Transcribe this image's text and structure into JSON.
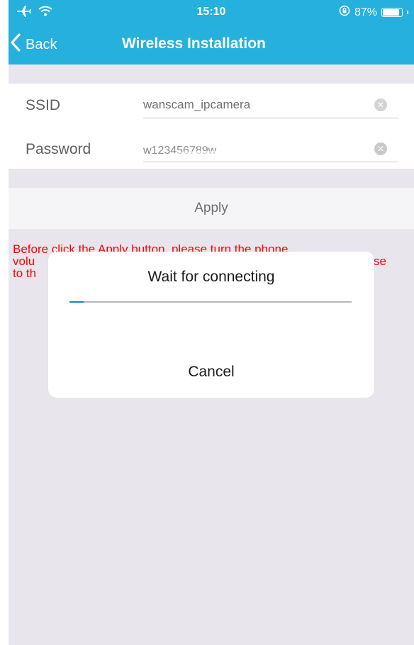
{
  "status_bar": {
    "time": "15:10",
    "battery_percent": "87%",
    "battery_level": 0.87,
    "icons": [
      "airplane-icon",
      "wifi-icon",
      "rotation-lock-icon",
      "battery-icon"
    ]
  },
  "nav": {
    "back_label": "Back",
    "title": "Wireless Installation"
  },
  "form": {
    "ssid_label": "SSID",
    "ssid_value": "wanscam_ipcamera",
    "password_label": "Password",
    "password_value": "w123456789w"
  },
  "apply_label": "Apply",
  "warning_lines": [
    "Before click the Apply button, please turn the phone",
    "volu",
    "to th"
  ],
  "warning_line2_tail": "se",
  "dialog": {
    "title": "Wait for connecting",
    "progress": 0.05,
    "cancel_label": "Cancel"
  },
  "colors": {
    "accent": "#25b0dd",
    "warning": "#ff0000",
    "progress": "#1e7be0"
  }
}
